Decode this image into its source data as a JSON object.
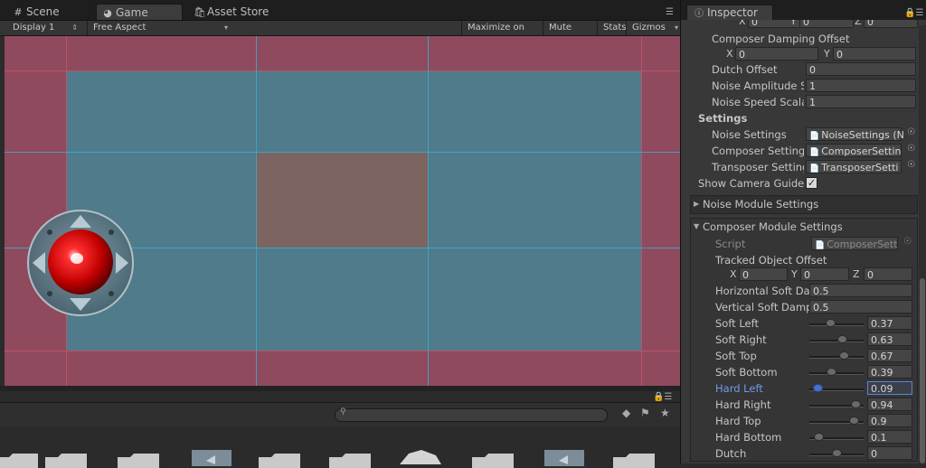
{
  "tabs": {
    "scene": {
      "label": "Scene",
      "icon": "grid-icon"
    },
    "game": {
      "label": "Game",
      "icon": "pacman-icon"
    },
    "asset_store": {
      "label": "Asset Store",
      "icon": "shopping-bag-icon"
    },
    "menu_icon": "kebab-icon"
  },
  "game_toolbar": {
    "display": "Display 1",
    "aspect": "Free Aspect",
    "maximize": "Maximize on Play",
    "mute": "Mute audio",
    "stats": "Stats",
    "gizmos": "Gizmos"
  },
  "colors": {
    "game_bg": "#8f4a5e",
    "soft_zone": "#4f7b8a",
    "dead_zone": "#7d6461",
    "guide_red": "#c4546b",
    "guide_blue": "#3aa9c9",
    "highlight": "#6f9be8"
  },
  "inspector": {
    "tab_label": "Inspector",
    "tab_icon": "info-icon",
    "top_xyz": {
      "x": "X",
      "x_val": "0",
      "y": "Y",
      "y_val": "0",
      "z": "Z",
      "z_val": "0"
    },
    "composer_damping_offset": {
      "label": "Composer Damping Offset",
      "x": "X",
      "x_val": "0",
      "y": "Y",
      "y_val": "0"
    },
    "dutch_offset": {
      "label": "Dutch Offset",
      "value": "0"
    },
    "noise_amplitude": {
      "label": "Noise Amplitude Sc",
      "value": "1"
    },
    "noise_speed": {
      "label": "Noise Speed Scalar",
      "value": "1"
    },
    "settings_header": "Settings",
    "noise_settings": {
      "label": "Noise Settings",
      "value": "NoiseSettings (N"
    },
    "composer_settings": {
      "label": "Composer Settings",
      "value": "ComposerSettin"
    },
    "transposer_settings": {
      "label": "Transposer Setting",
      "value": "TransposerSetti"
    },
    "show_camera_guides": {
      "label": "Show Camera Guides",
      "checked": true
    },
    "noise_module": "Noise Module Settings",
    "composer_module": "Composer Module Settings",
    "script": {
      "label": "Script",
      "value": "ComposerSetti"
    },
    "tracked_offset": {
      "label": "Tracked Object Offset",
      "x": "X",
      "x_val": "0",
      "y": "Y",
      "y_val": "0",
      "z": "Z",
      "z_val": "0"
    },
    "horizontal_soft": {
      "label": "Horizontal Soft Dan",
      "value": "0.5"
    },
    "vertical_soft": {
      "label": "Vertical Soft Dampe",
      "value": "0.5"
    },
    "sliders": [
      {
        "label": "Soft Left",
        "value": "0.37",
        "level": 0.37
      },
      {
        "label": "Soft Right",
        "value": "0.63",
        "level": 0.63
      },
      {
        "label": "Soft Top",
        "value": "0.67",
        "level": 0.67
      },
      {
        "label": "Soft Bottom",
        "value": "0.39",
        "level": 0.39
      },
      {
        "label": "Hard Left",
        "value": "0.09",
        "level": 0.09
      },
      {
        "label": "Hard Right",
        "value": "0.94",
        "level": 0.94
      },
      {
        "label": "Hard Top",
        "value": "0.9",
        "level": 0.9
      },
      {
        "label": "Hard Bottom",
        "value": "0.1",
        "level": 0.1
      },
      {
        "label": "Dutch",
        "value": "0",
        "level": 0.5
      }
    ]
  }
}
